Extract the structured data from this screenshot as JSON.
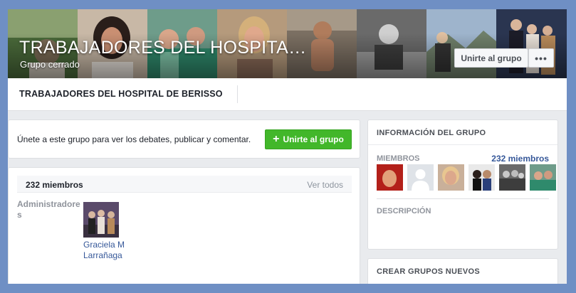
{
  "cover": {
    "title": "TRABAJADORES DEL HOSPITA…",
    "privacy": "Grupo cerrado",
    "join_label": "Unirte al grupo",
    "more_label": "•••"
  },
  "namebar": {
    "group_name": "TRABAJADORES DEL HOSPITAL DE BERISSO"
  },
  "join_prompt": {
    "text": "Únete a este grupo para ver los debates, publicar y comentar.",
    "button_label": "Unirte al grupo",
    "button_icon": "plus-icon",
    "accent": "#42b72a"
  },
  "members_panel": {
    "count_label": "232 miembros",
    "see_all": "Ver todos",
    "admins_label": "Administradores",
    "admin_name": "Graciela M Larrañaga"
  },
  "group_info": {
    "title": "INFORMACIÓN DEL GRUPO",
    "members_label": "MIEMBROS",
    "members_count": "232 miembros",
    "description_label": "DESCRIPCIÓN"
  },
  "create_groups": {
    "title": "CREAR GRUPOS NUEVOS"
  },
  "colors": {
    "link": "#365899",
    "page_bg": "#e9ebee",
    "frame_bg": "#6f8fc4"
  }
}
